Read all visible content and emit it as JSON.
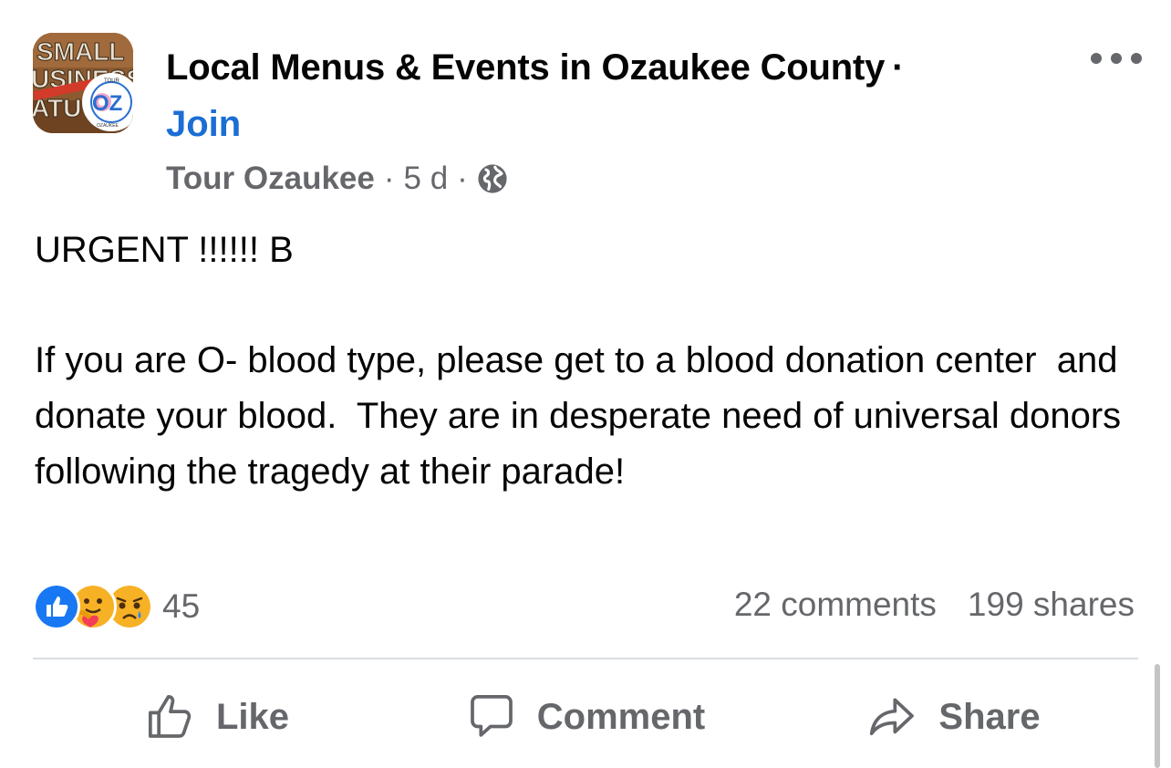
{
  "post": {
    "group_name": "Local Menus & Events in Ozaukee County",
    "group_name_sep": "·",
    "join_label": "Join",
    "author": "Tour Ozaukee",
    "meta_sep": "·",
    "timestamp": "5 d",
    "privacy_icon": "globe-icon",
    "more_icon": "more-options-icon",
    "body_line1": "URGENT !!!!!! B",
    "body_paragraph": "If you are O- blood type, please get to a blood donation center  and donate your blood.  They are in desperate need of universal donors following the tragedy at their parade!",
    "reaction_icons": [
      "like-reaction-icon",
      "care-reaction-icon",
      "sad-reaction-icon"
    ],
    "reaction_count": "45",
    "comments_count": "22 comments",
    "shares_count": "199 shares"
  },
  "actions": {
    "like_label": "Like",
    "comment_label": "Comment",
    "share_label": "Share"
  },
  "colors": {
    "join_blue": "#1b6ed4",
    "secondary_text": "#65676b",
    "like_blue": "#1877f2",
    "care_yellow": "#f7b125",
    "divider": "#dadde1"
  },
  "avatar": {
    "logo_text_top": "SMALL",
    "logo_text_mid": "USINESS",
    "logo_text_low": "ATU",
    "badge_top": "TOUR",
    "badge_letters": "OZ",
    "badge_bottom": "OZAUKEE"
  }
}
